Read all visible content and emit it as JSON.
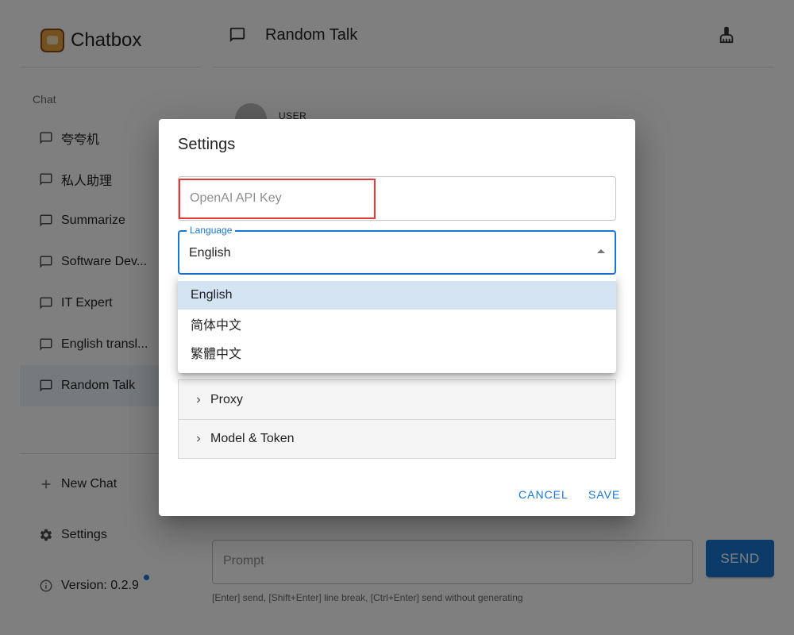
{
  "app": {
    "name": "Chatbox"
  },
  "sidebar": {
    "section_label": "Chat",
    "items": [
      {
        "label": "夸夸机"
      },
      {
        "label": "私人助理"
      },
      {
        "label": "Summarize"
      },
      {
        "label": "Software Dev..."
      },
      {
        "label": "IT Expert"
      },
      {
        "label": "English transl..."
      },
      {
        "label": "Random Talk"
      }
    ],
    "new_chat_label": "New Chat",
    "settings_label": "Settings",
    "version_label": "Version: 0.2.9"
  },
  "main": {
    "title": "Random Talk",
    "message_role": "USER",
    "prompt_placeholder": "Prompt",
    "send_label": "SEND",
    "hint": "[Enter] send, [Shift+Enter] line break, [Ctrl+Enter] send without generating"
  },
  "dialog": {
    "title": "Settings",
    "api_key_placeholder": "OpenAI API Key",
    "language_label": "Language",
    "language_value": "English",
    "sections": [
      {
        "label": "Proxy"
      },
      {
        "label": "Model & Token"
      }
    ],
    "cancel_label": "CANCEL",
    "save_label": "SAVE"
  },
  "language_menu": {
    "options": [
      "English",
      "简体中文",
      "繁體中文"
    ],
    "selected": "English"
  },
  "colors": {
    "accent": "#1976d2",
    "highlight_border": "#e53935",
    "menu_selected": "#d5e4f3"
  }
}
